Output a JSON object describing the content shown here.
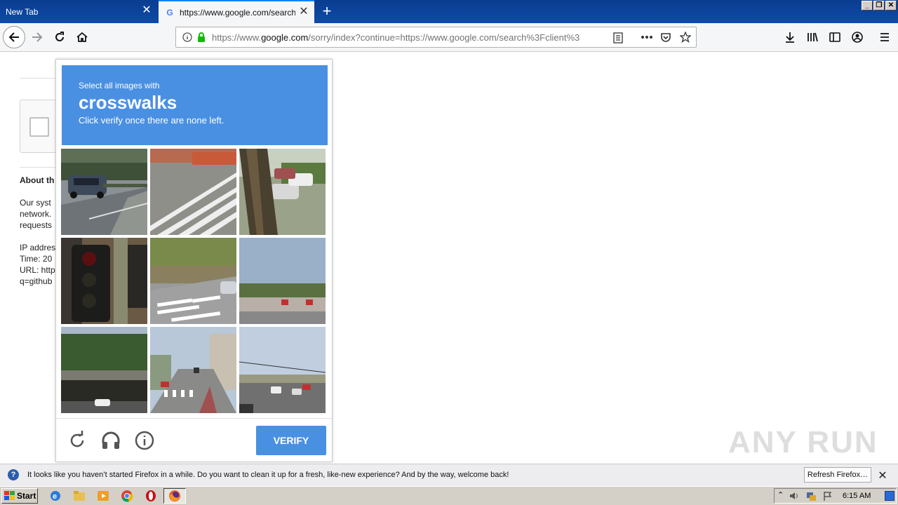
{
  "tabs": [
    {
      "label": "New Tab",
      "active": false
    },
    {
      "label": "https://www.google.com/search?c",
      "active": true
    }
  ],
  "window_controls": {
    "minimize": "_",
    "maximize": "❐",
    "close": "✕"
  },
  "url": {
    "prefix": "https://www.",
    "domain": "google.com",
    "path": "/sorry/index?continue=https://www.google.com/search%3Fclient%3"
  },
  "background_page": {
    "heading": "About th",
    "para1": [
      "Our syst",
      "network.",
      "requests"
    ],
    "info": [
      "IP addres",
      "Time: 20",
      "URL: http",
      "q=github"
    ]
  },
  "captcha": {
    "small": "Select all images with",
    "target": "crosswalks",
    "instruction": "Click verify once there are none left.",
    "verify_label": "VERIFY",
    "tiles": [
      "cars-parking-lot",
      "crosswalk-lines",
      "tree-parked-cars",
      "traffic-light-closeup",
      "crosswalk-road",
      "shopping-center",
      "overpass-bridge",
      "street-crosswalk",
      "intersection-traffic"
    ]
  },
  "notification": {
    "text": "It looks like you haven’t started Firefox in a while. Do you want to clean it up for a fresh, like-new experience? And by the way, welcome back!",
    "button": "Refresh Firefox…"
  },
  "watermark": "ANY RUN",
  "taskbar": {
    "start": "Start",
    "clock": "6:15 AM"
  },
  "colors": {
    "captcha_blue": "#4a90e2",
    "tab_strip": "#0e4aa8"
  }
}
